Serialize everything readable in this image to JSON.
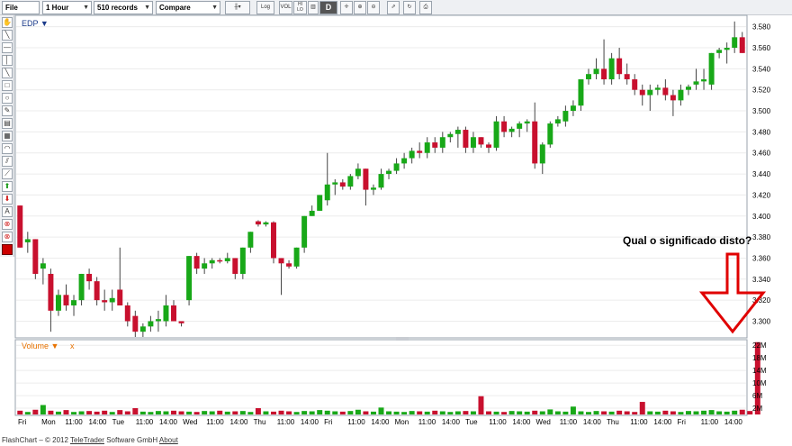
{
  "toolbar": {
    "file_label": "File",
    "interval": "1 Hour",
    "records": "510 records",
    "compare": "Compare",
    "log_label": "Log",
    "vol_label": "VOL",
    "hi_lo_label": "HI LO",
    "d_label": "D"
  },
  "chart": {
    "symbol_label": "EDP ▼",
    "volume_label": "Volume ▼",
    "volume_close": "x",
    "annotation": "Qual o significado disto?",
    "price_ticks": [
      "3.580",
      "3.560",
      "3.540",
      "3.520",
      "3.500",
      "3.480",
      "3.460",
      "3.440",
      "3.420",
      "3.400",
      "3.380",
      "3.360",
      "3.340",
      "3.320",
      "3.300"
    ],
    "volume_ticks": [
      "22M",
      "18M",
      "14M",
      "10M",
      "6M",
      "2M"
    ],
    "x_labels": [
      "Fri",
      "Mon",
      "11:00",
      "14:00",
      "Tue",
      "11:00",
      "14:00",
      "Wed",
      "11:00",
      "14:00",
      "Thu",
      "11:00",
      "14:00",
      "Fri",
      "11:00",
      "14:00",
      "Mon",
      "11:00",
      "14:00",
      "Tue",
      "11:00",
      "14:00",
      "Wed",
      "11:00",
      "14:00",
      "Thu",
      "11:00",
      "14:00",
      "Fri",
      "11:00",
      "14:00"
    ]
  },
  "colors": {
    "up": "#18a818",
    "down": "#c8102e",
    "annotation_arrow": "#e00000"
  },
  "chart_data": {
    "type": "candlestick",
    "title": "EDP",
    "interval": "1 Hour",
    "ylim": [
      3.285,
      3.59
    ],
    "volume_ylim": [
      0,
      23.5
    ],
    "volume_unit": "M",
    "candles": [
      {
        "o": 3.41,
        "h": 3.41,
        "l": 3.37,
        "c": 3.37
      },
      {
        "o": 3.375,
        "h": 3.385,
        "l": 3.365,
        "c": 3.378
      },
      {
        "o": 3.378,
        "h": 3.378,
        "l": 3.34,
        "c": 3.345
      },
      {
        "o": 3.35,
        "h": 3.36,
        "l": 3.335,
        "c": 3.355
      },
      {
        "o": 3.345,
        "h": 3.35,
        "l": 3.29,
        "c": 3.31
      },
      {
        "o": 3.31,
        "h": 3.33,
        "l": 3.305,
        "c": 3.325
      },
      {
        "o": 3.325,
        "h": 3.335,
        "l": 3.31,
        "c": 3.315
      },
      {
        "o": 3.315,
        "h": 3.325,
        "l": 3.305,
        "c": 3.32
      },
      {
        "o": 3.32,
        "h": 3.345,
        "l": 3.315,
        "c": 3.345
      },
      {
        "o": 3.345,
        "h": 3.35,
        "l": 3.33,
        "c": 3.338
      },
      {
        "o": 3.338,
        "h": 3.342,
        "l": 3.315,
        "c": 3.32
      },
      {
        "o": 3.32,
        "h": 3.33,
        "l": 3.31,
        "c": 3.318
      },
      {
        "o": 3.318,
        "h": 3.33,
        "l": 3.31,
        "c": 3.322
      },
      {
        "o": 3.33,
        "h": 3.37,
        "l": 3.315,
        "c": 3.315
      },
      {
        "o": 3.315,
        "h": 3.318,
        "l": 3.295,
        "c": 3.3
      },
      {
        "o": 3.305,
        "h": 3.31,
        "l": 3.285,
        "c": 3.29
      },
      {
        "o": 3.29,
        "h": 3.298,
        "l": 3.285,
        "c": 3.295
      },
      {
        "o": 3.295,
        "h": 3.305,
        "l": 3.29,
        "c": 3.3
      },
      {
        "o": 3.3,
        "h": 3.31,
        "l": 3.29,
        "c": 3.302
      },
      {
        "o": 3.3,
        "h": 3.325,
        "l": 3.295,
        "c": 3.315
      },
      {
        "o": 3.315,
        "h": 3.32,
        "l": 3.3,
        "c": 3.3
      },
      {
        "o": 3.3,
        "h": 3.3,
        "l": 3.295,
        "c": 3.298
      },
      {
        "o": 3.32,
        "h": 3.362,
        "l": 3.315,
        "c": 3.362
      },
      {
        "o": 3.362,
        "h": 3.365,
        "l": 3.345,
        "c": 3.35
      },
      {
        "o": 3.35,
        "h": 3.36,
        "l": 3.345,
        "c": 3.355
      },
      {
        "o": 3.355,
        "h": 3.36,
        "l": 3.35,
        "c": 3.358
      },
      {
        "o": 3.358,
        "h": 3.36,
        "l": 3.355,
        "c": 3.357
      },
      {
        "o": 3.357,
        "h": 3.365,
        "l": 3.355,
        "c": 3.36
      },
      {
        "o": 3.36,
        "h": 3.36,
        "l": 3.34,
        "c": 3.345
      },
      {
        "o": 3.345,
        "h": 3.37,
        "l": 3.34,
        "c": 3.37
      },
      {
        "o": 3.37,
        "h": 3.385,
        "l": 3.365,
        "c": 3.385
      },
      {
        "o": 3.395,
        "h": 3.396,
        "l": 3.39,
        "c": 3.392
      },
      {
        "o": 3.392,
        "h": 3.395,
        "l": 3.39,
        "c": 3.394
      },
      {
        "o": 3.394,
        "h": 3.395,
        "l": 3.355,
        "c": 3.36
      },
      {
        "o": 3.36,
        "h": 3.36,
        "l": 3.325,
        "c": 3.355
      },
      {
        "o": 3.355,
        "h": 3.358,
        "l": 3.35,
        "c": 3.352
      },
      {
        "o": 3.352,
        "h": 3.37,
        "l": 3.35,
        "c": 3.37
      },
      {
        "o": 3.37,
        "h": 3.4,
        "l": 3.365,
        "c": 3.4
      },
      {
        "o": 3.4,
        "h": 3.41,
        "l": 3.4,
        "c": 3.405
      },
      {
        "o": 3.405,
        "h": 3.42,
        "l": 3.405,
        "c": 3.42
      },
      {
        "o": 3.415,
        "h": 3.46,
        "l": 3.41,
        "c": 3.43
      },
      {
        "o": 3.43,
        "h": 3.435,
        "l": 3.42,
        "c": 3.432
      },
      {
        "o": 3.432,
        "h": 3.435,
        "l": 3.425,
        "c": 3.428
      },
      {
        "o": 3.428,
        "h": 3.44,
        "l": 3.425,
        "c": 3.438
      },
      {
        "o": 3.438,
        "h": 3.45,
        "l": 3.435,
        "c": 3.445
      },
      {
        "o": 3.445,
        "h": 3.445,
        "l": 3.41,
        "c": 3.425
      },
      {
        "o": 3.425,
        "h": 3.43,
        "l": 3.42,
        "c": 3.427
      },
      {
        "o": 3.427,
        "h": 3.445,
        "l": 3.425,
        "c": 3.44
      },
      {
        "o": 3.44,
        "h": 3.445,
        "l": 3.435,
        "c": 3.443
      },
      {
        "o": 3.443,
        "h": 3.455,
        "l": 3.44,
        "c": 3.45
      },
      {
        "o": 3.45,
        "h": 3.46,
        "l": 3.445,
        "c": 3.455
      },
      {
        "o": 3.455,
        "h": 3.465,
        "l": 3.45,
        "c": 3.462
      },
      {
        "o": 3.462,
        "h": 3.47,
        "l": 3.455,
        "c": 3.46
      },
      {
        "o": 3.46,
        "h": 3.475,
        "l": 3.455,
        "c": 3.47
      },
      {
        "o": 3.47,
        "h": 3.475,
        "l": 3.46,
        "c": 3.465
      },
      {
        "o": 3.465,
        "h": 3.48,
        "l": 3.46,
        "c": 3.475
      },
      {
        "o": 3.475,
        "h": 3.48,
        "l": 3.47,
        "c": 3.478
      },
      {
        "o": 3.478,
        "h": 3.485,
        "l": 3.465,
        "c": 3.482
      },
      {
        "o": 3.482,
        "h": 3.485,
        "l": 3.46,
        "c": 3.465
      },
      {
        "o": 3.465,
        "h": 3.48,
        "l": 3.46,
        "c": 3.475
      },
      {
        "o": 3.475,
        "h": 3.475,
        "l": 3.465,
        "c": 3.468
      },
      {
        "o": 3.468,
        "h": 3.47,
        "l": 3.46,
        "c": 3.465
      },
      {
        "o": 3.465,
        "h": 3.495,
        "l": 3.462,
        "c": 3.49
      },
      {
        "o": 3.49,
        "h": 3.495,
        "l": 3.475,
        "c": 3.48
      },
      {
        "o": 3.48,
        "h": 3.485,
        "l": 3.475,
        "c": 3.483
      },
      {
        "o": 3.483,
        "h": 3.49,
        "l": 3.475,
        "c": 3.488
      },
      {
        "o": 3.488,
        "h": 3.492,
        "l": 3.48,
        "c": 3.49
      },
      {
        "o": 3.49,
        "h": 3.508,
        "l": 3.445,
        "c": 3.45
      },
      {
        "o": 3.45,
        "h": 3.47,
        "l": 3.44,
        "c": 3.468
      },
      {
        "o": 3.468,
        "h": 3.49,
        "l": 3.465,
        "c": 3.488
      },
      {
        "o": 3.488,
        "h": 3.495,
        "l": 3.485,
        "c": 3.492
      },
      {
        "o": 3.49,
        "h": 3.505,
        "l": 3.485,
        "c": 3.5
      },
      {
        "o": 3.5,
        "h": 3.51,
        "l": 3.495,
        "c": 3.505
      },
      {
        "o": 3.505,
        "h": 3.53,
        "l": 3.5,
        "c": 3.53
      },
      {
        "o": 3.53,
        "h": 3.54,
        "l": 3.525,
        "c": 3.535
      },
      {
        "o": 3.535,
        "h": 3.55,
        "l": 3.53,
        "c": 3.54
      },
      {
        "o": 3.54,
        "h": 3.568,
        "l": 3.525,
        "c": 3.53
      },
      {
        "o": 3.53,
        "h": 3.555,
        "l": 3.525,
        "c": 3.55
      },
      {
        "o": 3.55,
        "h": 3.56,
        "l": 3.53,
        "c": 3.535
      },
      {
        "o": 3.535,
        "h": 3.545,
        "l": 3.525,
        "c": 3.53
      },
      {
        "o": 3.53,
        "h": 3.535,
        "l": 3.515,
        "c": 3.52
      },
      {
        "o": 3.52,
        "h": 3.525,
        "l": 3.505,
        "c": 3.515
      },
      {
        "o": 3.515,
        "h": 3.525,
        "l": 3.5,
        "c": 3.52
      },
      {
        "o": 3.52,
        "h": 3.525,
        "l": 3.515,
        "c": 3.522
      },
      {
        "o": 3.522,
        "h": 3.53,
        "l": 3.51,
        "c": 3.515
      },
      {
        "o": 3.515,
        "h": 3.52,
        "l": 3.495,
        "c": 3.51
      },
      {
        "o": 3.51,
        "h": 3.525,
        "l": 3.505,
        "c": 3.52
      },
      {
        "o": 3.52,
        "h": 3.525,
        "l": 3.515,
        "c": 3.523
      },
      {
        "o": 3.525,
        "h": 3.54,
        "l": 3.52,
        "c": 3.528
      },
      {
        "o": 3.528,
        "h": 3.54,
        "l": 3.52,
        "c": 3.53
      },
      {
        "o": 3.525,
        "h": 3.555,
        "l": 3.52,
        "c": 3.555
      },
      {
        "o": 3.555,
        "h": 3.56,
        "l": 3.55,
        "c": 3.558
      },
      {
        "o": 3.558,
        "h": 3.565,
        "l": 3.545,
        "c": 3.56
      },
      {
        "o": 3.56,
        "h": 3.585,
        "l": 3.555,
        "c": 3.57
      },
      {
        "o": 3.57,
        "h": 3.575,
        "l": 3.555,
        "c": 3.555
      }
    ],
    "volume": [
      1.2,
      0.8,
      1.5,
      3.0,
      1.2,
      0.9,
      1.4,
      0.8,
      1.0,
      1.1,
      0.9,
      1.2,
      0.8,
      1.4,
      1.0,
      2.0,
      0.9,
      0.8,
      1.1,
      1.0,
      1.2,
      1.0,
      0.9,
      0.8,
      1.1,
      1.0,
      1.2,
      0.9,
      1.0,
      1.1,
      0.8,
      2.0,
      1.0,
      0.9,
      1.2,
      1.0,
      0.8,
      1.1,
      1.0,
      1.4,
      1.2,
      1.0,
      0.9,
      1.1,
      1.5,
      1.0,
      0.9,
      2.2,
      1.0,
      0.9,
      0.8,
      1.1,
      1.0,
      0.9,
      1.2,
      1.0,
      0.8,
      1.0,
      1.1,
      1.0,
      5.8,
      1.0,
      0.9,
      0.8,
      1.1,
      1.0,
      0.9,
      1.2,
      1.0,
      1.6,
      1.0,
      0.9,
      2.5,
      1.0,
      0.8,
      1.1,
      1.0,
      0.9,
      1.2,
      1.0,
      0.8,
      4.0,
      1.0,
      0.9,
      1.2,
      1.0,
      0.8,
      1.1,
      1.0,
      1.2,
      1.4,
      1.0,
      0.9,
      1.2,
      1.5,
      1.1,
      23.0
    ]
  }
}
